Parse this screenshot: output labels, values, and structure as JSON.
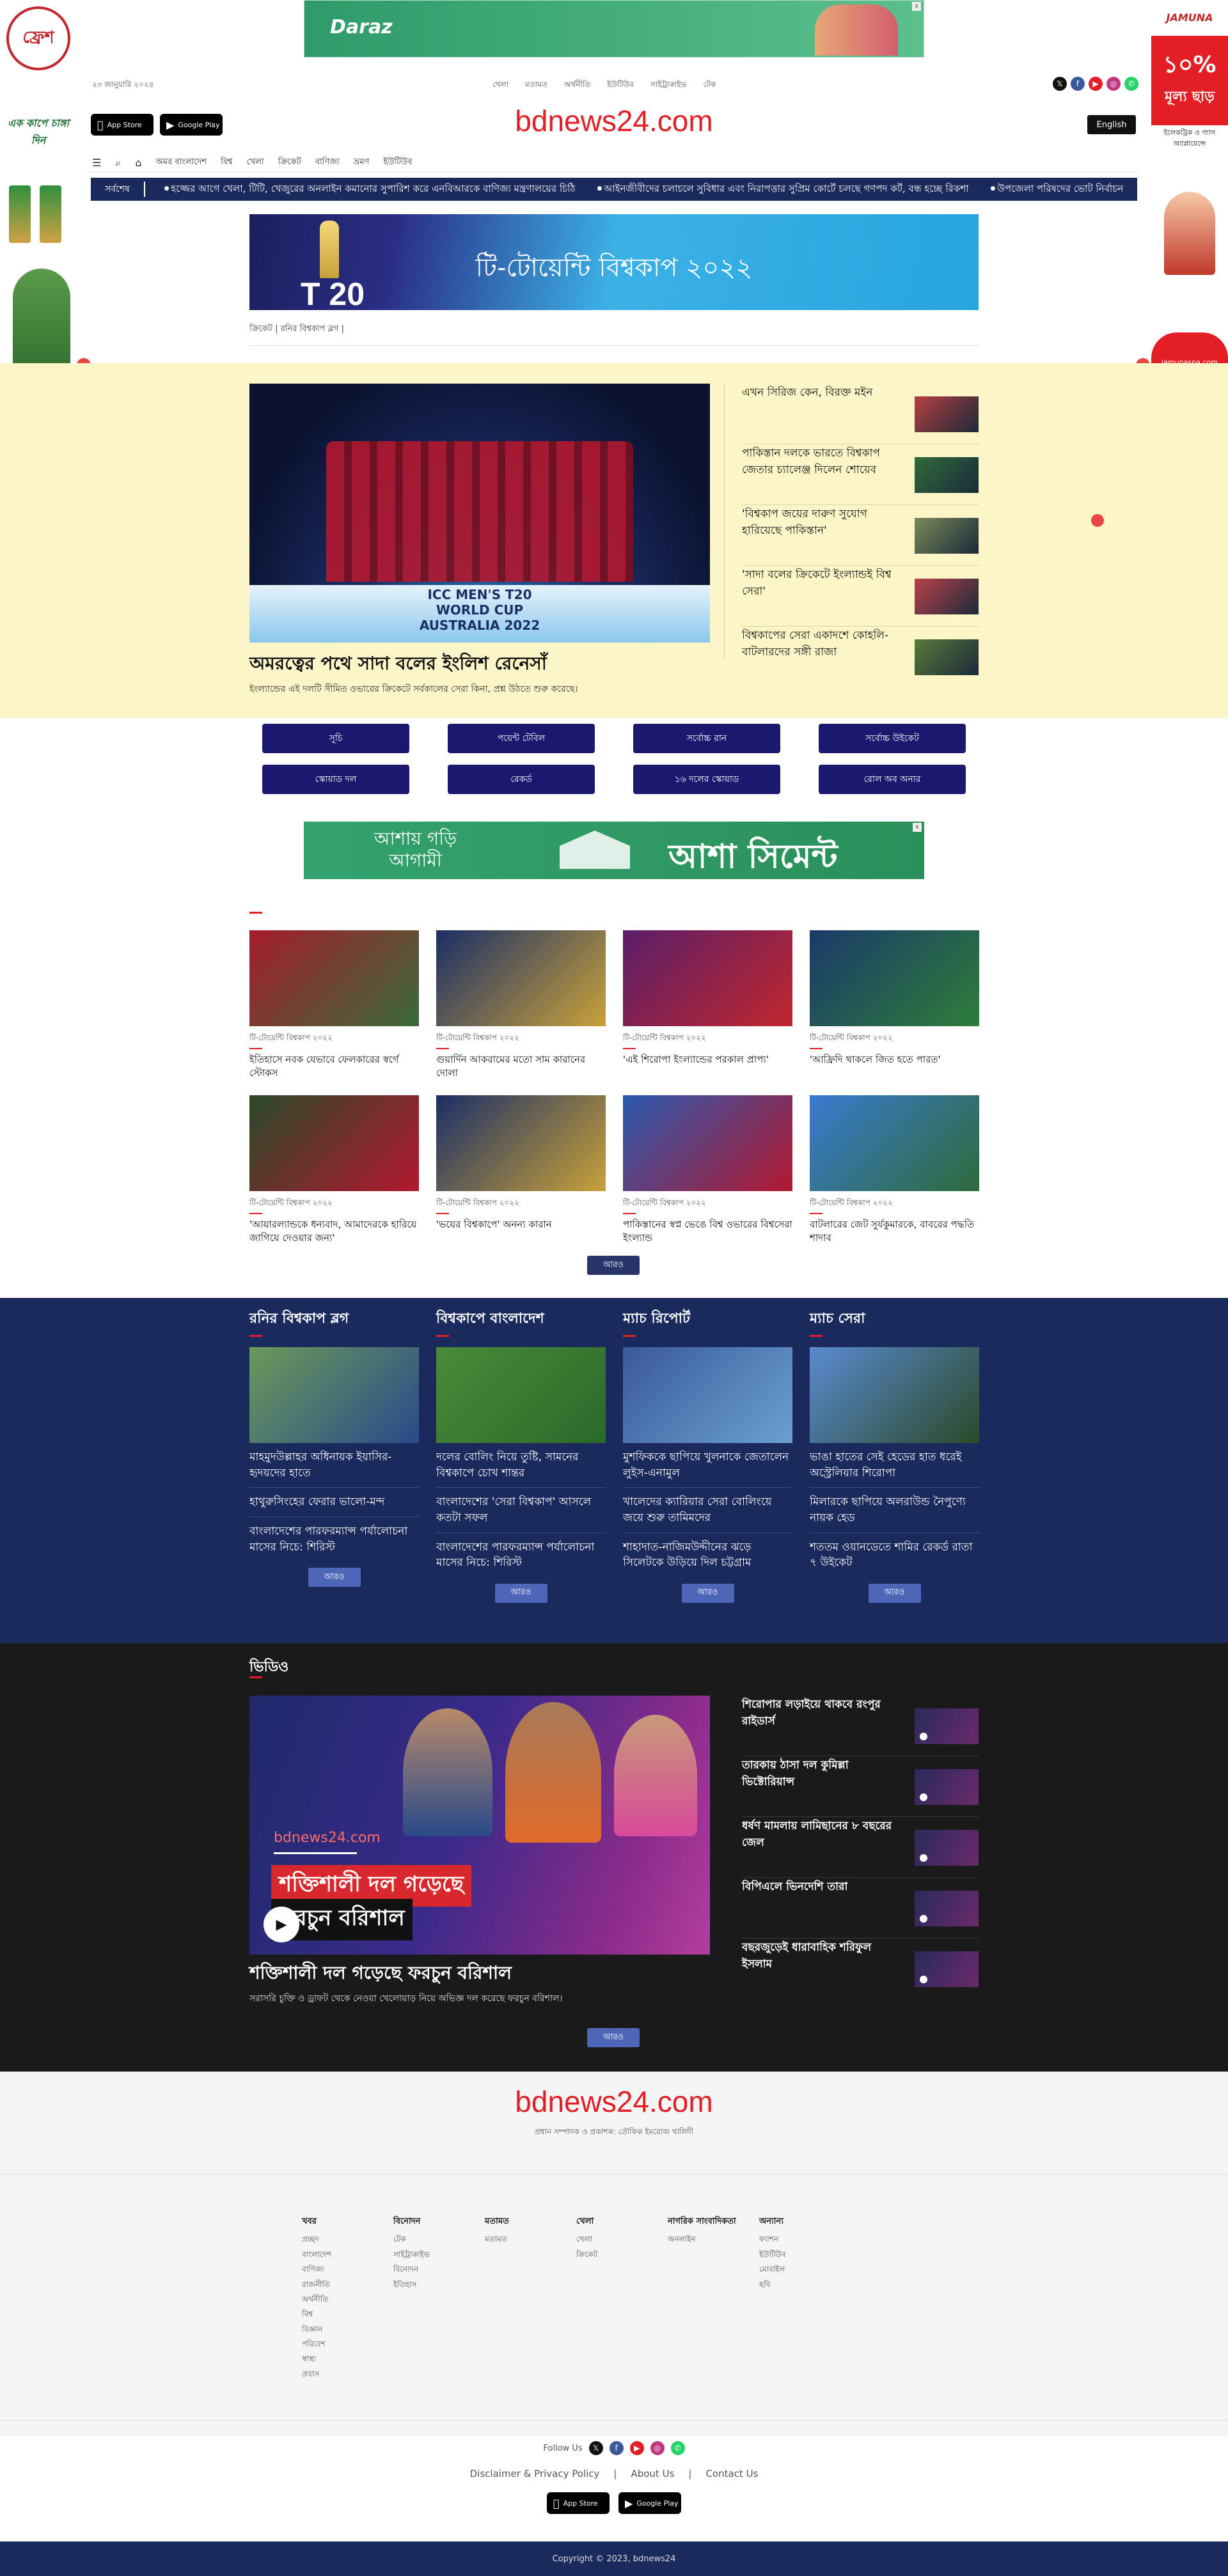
{
  "skin_left": {
    "logo_text": "ফ্রেশ",
    "tagline": "এক কাপে চাঙ্গা দিন"
  },
  "skin_right": {
    "brand": "JAMUNA",
    "percent": "১০%",
    "percent_label": "মূল্য ছাড়",
    "promo": "ইলেকট্রিক ও গ্যাস অ্যাপ্লায়েন্সে",
    "site": "jamunaspa.com"
  },
  "ad_top": {
    "brand": "Daraz",
    "close": "x"
  },
  "topbar": {
    "date": "২৩ জানুয়ারি ২০২৪",
    "nav": [
      "খেলা",
      "মতামত",
      "অর্থনীতি",
      "ইউটিউব",
      "সাইট্রাকাইভ",
      "টেক"
    ]
  },
  "apps": {
    "appstore_small": "Download on the",
    "appstore": "App Store",
    "gplay_small": "GET IT ON",
    "gplay": "Google Play"
  },
  "logo": "bdnews24.com",
  "english_button": "English",
  "main_nav": [
    "অমর বাংলাদেশ",
    "বিশ্ব",
    "খেলা",
    "ক্রিকেট",
    "বাণিজ্য",
    "ভ্রমণ",
    "ইউটিউব"
  ],
  "ticker": {
    "label": "সর্বশেষ",
    "items": [
      "হজ্জের আগে খেলা, টিটি, খেজুরের অনলাইন কমানোর সুপারিশ করে এনবিআরকে বাণিজ্য মন্ত্রণালয়ের চিঠি",
      "আইনজীবীদের চলাচলে সুবিধার এবং নিরাপত্তার সুপ্রিম কোর্টে চলছে গণপদ কর্ট, বন্ধ হচ্ছে রিকশা",
      "উপজেলা পরিষদের ভোট নির্বাচন"
    ]
  },
  "banner": {
    "t20": "T 20",
    "title": "টি-টোয়েন্টি বিশ্বকাপ ২০২২"
  },
  "breadcrumb": "ক্রিকেট | রনির বিশ্বকাপ ব্লগ |",
  "lead": {
    "img_caption": "ICC MEN'S T20 WORLD CUP AUSTRALIA 2022",
    "title": "অমরত্বের পথে সাদা বলের ইংলিশ রেনেসাঁ",
    "subtitle": "ইংল্যান্ডের এই দলটি সীমিত ওভারের ক্রিকেটে সর্বকালের সেরা কিনা, প্রশ্ন উঠতে শুরু করেছে।"
  },
  "side_list": [
    {
      "title": "এখন সিরিজ কেন, বিরক্ত মইন",
      "color": "#b54040"
    },
    {
      "title": "পাকিস্তান দলকে ভারতে বিশ্বকাপ জেতার চ্যালেঞ্জ দিলেন শোয়েব",
      "color": "#2f6b3a"
    },
    {
      "title": "'বিশ্বকাপ জয়ের দারুণ সুযোগ হারিয়েছে পাকিস্তান'",
      "color": "#7a8a5a"
    },
    {
      "title": "'সাদা বলের ক্রিকেটে ইংল্যান্ডই বিশ্ব সেরা'",
      "color": "#b9414a"
    },
    {
      "title": "বিশ্বকাপের সেরা একাদশে কোহলি-বাটলারদের সঙ্গী রাজা",
      "color": "#5a7a3a"
    }
  ],
  "button_rows": [
    [
      "সূচি",
      "পয়েন্ট টেবিল",
      "সর্বোচ্চ রান",
      "সর্বোচ্চ উইকেট"
    ],
    [
      "স্কোয়াড দল",
      "রেকর্ড",
      "১৬ দলের স্কোয়াড",
      "রোল অব অনার"
    ]
  ],
  "ad_mid": {
    "line1": "আশায় গড়ি",
    "line2": "আগামী",
    "brand": "আশা সিমেন্ট",
    "close": "x"
  },
  "grid": [
    {
      "cat": "টি-টোয়েন্টি বিশ্বকাপ ২০২২",
      "title": "ইতিহাসে নবক যেভাবে ফেলকারের স্বর্গে স্টোকস",
      "c1": "#a51d2d",
      "c2": "#3a6a3a"
    },
    {
      "cat": "টি-টোয়েন্টি বিশ্বকাপ ২০২২",
      "title": "গুয়ার্দিন আকরামের মতো সাম কারানের দোলা",
      "c1": "#1b2f66",
      "c2": "#c9a13a"
    },
    {
      "cat": "টি-টোয়েন্টি বিশ্বকাপ ২০২২",
      "title": "'এই শিরোপা ইংল্যান্ডের পরকাল প্রাপ্য'",
      "c1": "#5a1e6a",
      "c2": "#c1272d"
    },
    {
      "cat": "টি-টোয়েন্টি বিশ্বকাপ ২০২২",
      "title": "'আফ্রিদি থাকলে জিত হতে পারত'",
      "c1": "#1a3a6a",
      "c2": "#2e7d3a"
    },
    {
      "cat": "টি-টোয়েন্টি বিশ্বকাপ ২০২২",
      "title": "'আয়ারল্যান্ডকে ধন্যবাদ, আমাদেরকে হারিয়ে জাগিয়ে দেওয়ার জন্য'",
      "c1": "#2a4a2a",
      "c2": "#b3182f"
    },
    {
      "cat": "টি-টোয়েন্টি বিশ্বকাপ ২০২২",
      "title": "'ভয়ের বিশ্বকাপে' অনন্য কারান",
      "c1": "#1b2f66",
      "c2": "#c9a13a"
    },
    {
      "cat": "টি-টোয়েন্টি বিশ্বকাপ ২০২২",
      "title": "পাকিস্তানের স্বপ্ন ভেঙে বিশ্ব ওভারের বিশ্বসেরা ইংল্যান্ড",
      "c1": "#2a5ab0",
      "c2": "#b3182f"
    },
    {
      "cat": "টি-টোয়েন্টি বিশ্বকাপ ২০২২",
      "title": "বাটলারের জেট সুর্যকুমারকে, বাবরের পদ্ধতি শাদাব",
      "c1": "#3a7ad0",
      "c2": "#2e6b3a"
    }
  ],
  "grid_more": "আরও",
  "navy_cols": [
    {
      "head": "রনির বিশ্বকাপ ব্লগ",
      "t1": "মাহমুদউল্লাহর অধিনায়ক ইয়াসির-হৃদয়দের হাতে",
      "t2": "হাথুরুসিংহের ফেরার ভালো-মন্দ",
      "t3": "বাংলাদেশের পারফরম্যান্স পর্যালোচনা মাসের নিচে: শিরিস্ট",
      "c1": "#6a9a5a",
      "c2": "#2a4a8a"
    },
    {
      "head": "বিশ্বকাপে বাংলাদেশ",
      "t1": "দলের বোলিং নিয়ে তুষ্টি, সামনের বিশ্বকাপে চোখ শান্তর",
      "t2": "বাংলাদেশের 'সেরা বিশ্বকাপ' আসলে কতটা সফল",
      "t3": "বাংলাদেশের পারফরম্যান্স পর্যালোচনা মাসের নিচে: শিরিস্ট",
      "c1": "#4a8a3a",
      "c2": "#2a6a2a"
    },
    {
      "head": "ম্যাচ রিপোর্ট",
      "t1": "মুশফিককে ছাপিয়ে খুলনাকে জেতালেন লুইস-এনামুল",
      "t2": "খালেদের ক্যারিয়ার সেরা বোলিংয়ে জয়ে শুরু তামিমদের",
      "t3": "শাহাদাত-নাজিমউদ্দীনের ঝড়ে সিলেটকে উড়িয়ে দিল চট্টগ্রাম",
      "c1": "#3a5a9a",
      "c2": "#6aa0d0"
    },
    {
      "head": "ম্যাচ সেরা",
      "t1": "ভাঙা হাতের সেই হেডের হাত ধরেই অস্ট্রেলিয়ার শিরোপা",
      "t2": "মিলারকে ছাপিয়ে অলরাউন্ড নৈপুণ্যে নায়ক হেড",
      "t3": "শততম ওয়ানডেতে শামির রেকর্ড রাতা ৭ উইকেট",
      "c1": "#5a8ad0",
      "c2": "#2a4a2a"
    }
  ],
  "navy_more": "আরও",
  "video": {
    "head": "ভিডিও",
    "site": "bdnews24.com",
    "cap1": "শক্তিশালী দল গড়েছে",
    "cap2": "ফরচুন বরিশাল",
    "title": "শক্তিশালী দল গড়েছে ফরচুন বরিশাল",
    "subtitle": "সরাসরি চুক্তি ও ড্রাফট থেকে নেওয়া খেলোয়াড় নিয়ে অভিজ্ঞ দল করেছে ফরচুন বরিশাল।",
    "list": [
      "শিরোপার লড়াইয়ে থাকবে রংপুর রাইডার্স",
      "তারকায় ঠাসা দল কুমিল্লা ভিক্টোরিয়ান্স",
      "ধর্ষণ মামলায় লামিছানের ৮ বছরের জেল",
      "বিপিএলে ভিনদেশি তারা",
      "বছরজুড়েই ধারাবাহিক শরিফুল ইসলাম"
    ],
    "more": "আরও"
  },
  "footer": {
    "logo": "bdnews24.com",
    "tagline": "প্রধান সম্পাদক ও প্রকাশক: তৌফিক ইমরোজ খালিদী",
    "cols": [
      {
        "head": "খবর",
        "items": [
          "প্রচ্ছদ",
          "বাংলাদেশ",
          "বাণিজ্য",
          "রাজনীতি",
          "অর্থনীতি",
          "বিশ্ব",
          "বিজ্ঞান",
          "পরিবেশ",
          "স্বাস্থ্য",
          "প্রবাস"
        ]
      },
      {
        "head": "বিনোদন",
        "items": [
          "টেক",
          "সাইট্রাকাইভ",
          "বিনোদন",
          "ইতিহাস"
        ]
      },
      {
        "head": "মতামত",
        "items": [
          "মতামত"
        ]
      },
      {
        "head": "খেলা",
        "items": [
          "খেলা",
          "ক্রিকেট"
        ]
      },
      {
        "head": "নাগরিক সাংবাদিকতা",
        "items": [
          "অনলাইন"
        ]
      },
      {
        "head": "অন্যান্য",
        "items": [
          "ফ্যাশন",
          "ইউটিউব",
          "মোবাইল",
          "ছবি"
        ]
      }
    ],
    "follow": "Follow Us",
    "links": [
      "Disclaimer & Privacy Policy",
      "About Us",
      "Contact Us"
    ],
    "copyright": "Copyright © 2023, bdnews24"
  }
}
